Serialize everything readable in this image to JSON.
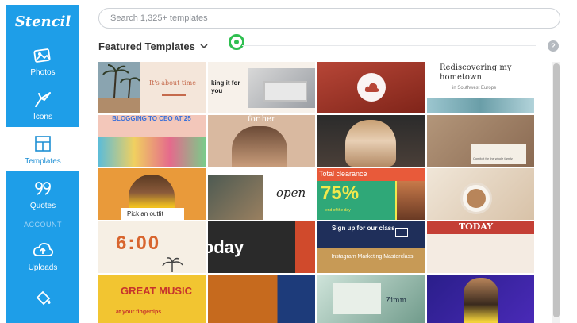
{
  "brand": {
    "name": "Stencil"
  },
  "sidebar": {
    "items": [
      {
        "label": "Photos",
        "icon": "photos-icon"
      },
      {
        "label": "Icons",
        "icon": "icons-icon"
      },
      {
        "label": "Templates",
        "icon": "templates-icon",
        "active": true
      },
      {
        "label": "Quotes",
        "icon": "quotes-icon"
      }
    ],
    "section_label": "ACCOUNT",
    "account_items": [
      {
        "label": "Uploads",
        "icon": "upload-cloud-icon"
      }
    ]
  },
  "search": {
    "placeholder": "Search 1,325+ templates"
  },
  "featured": {
    "title": "Featured Templates",
    "help": "?"
  },
  "templates": [
    {
      "text": "It's about time"
    },
    {
      "text": "king it for you"
    },
    {
      "text": ""
    },
    {
      "text": "Rediscovering my hometown",
      "sub": "in Southwest Europe"
    },
    {
      "text": "BLOGGING TO CEO AT 25"
    },
    {
      "text": "for her"
    },
    {
      "text": ""
    },
    {
      "text": "Comfort for the whole family"
    },
    {
      "text": "Pick an outfit"
    },
    {
      "text": "open"
    },
    {
      "text": "Total clearance",
      "big": "75%",
      "sub": "end of the day"
    },
    {
      "text": ""
    },
    {
      "text": "6:00"
    },
    {
      "text": "Today"
    },
    {
      "text": "Sign up for our class",
      "sub": "Instagram Marketing Masterclass"
    },
    {
      "text": "TODAY"
    },
    {
      "text": "GREAT MUSIC",
      "sub": "at your fingertips"
    },
    {
      "text": ""
    },
    {
      "text": "Zimm"
    },
    {
      "text": ""
    }
  ],
  "colors": {
    "sidebar": "#1e9ee8",
    "accent": "#2fbf50"
  }
}
